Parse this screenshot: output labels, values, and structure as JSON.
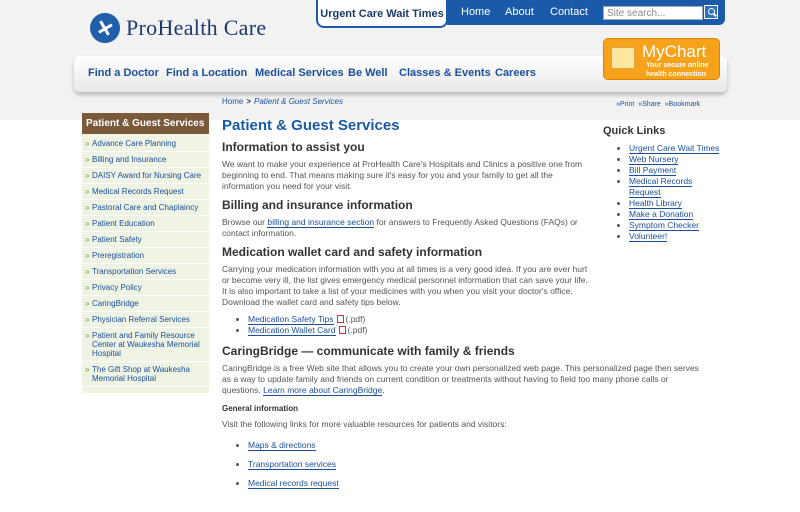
{
  "header": {
    "logo_text": "ProHealth Care",
    "urgent_care_tab": "Urgent Care Wait Times",
    "top_links": [
      "Home",
      "About",
      "Contact"
    ],
    "search_placeholder": "Site search...",
    "nav": [
      "Find a Doctor",
      "Find a Location",
      "Medical Services",
      "Be Well",
      "Classes & Events",
      "Careers"
    ],
    "mychart": {
      "title": "MyChart",
      "subtitle": "Your secure online health connection"
    }
  },
  "breadcrumb": {
    "home": "Home",
    "sep": ">",
    "current": "Patient & Guest Services"
  },
  "tools": [
    "»Print",
    "»Share",
    "»Bookmark"
  ],
  "sidebar": {
    "title": "Patient & Guest Services",
    "items": [
      "Advance Care Planning",
      "Billing and Insurance",
      "DAISY Award for Nursing Care",
      "Medical Records Request",
      "Pastoral Care and Chaplaincy",
      "Patient Education",
      "Patient Safety",
      "Preregistration",
      "Transportation Services",
      "Privacy Policy",
      "CaringBridge",
      "Physician Referral Services",
      "Patient and Family Resource Center at Waukesha Memorial Hospital",
      "The Gift Shop at Waukesha Memorial Hospital"
    ]
  },
  "main": {
    "title": "Patient & Guest Services",
    "assist_heading": "Information to assist you",
    "assist_text": "We want to make your experience at ProHealth Care's Hospitals and Clinics a positive one from beginning to end. That means making sure it's easy for you and your family to get all the information you need for your visit.",
    "billing_heading": "Billing and insurance information",
    "billing_text_pre": "Browse our ",
    "billing_link": "billing and insurance section",
    "billing_text_post": " for answers to Frequently Asked Questions (FAQs) or contact information.",
    "wallet_heading": "Medication wallet card and safety information",
    "wallet_text": "Carrying your medication information with you at all times is a very good idea. If you are ever hurt or become very ill, the list gives emergency medical personnel information that can save your life. It is also important to take a list of your medicines with you when you visit your doctor's office. Download the wallet card and safety tips below.",
    "pdf_links": [
      "Medication Safety Tips",
      "Medication Wallet Card"
    ],
    "pdf_suffix": "(.pdf)",
    "caring_heading": "CaringBridge — communicate with family & friends",
    "caring_text": "CaringBridge is a free Web site that allows you to create your own personalized web page.  This personalized page then serves as a way to update family and friends on current condition or treatments without having to field too many phone calls or questions. ",
    "caring_link": "Learn more about CaringBridge",
    "caring_text_end": ".",
    "general_heading": "General information",
    "general_text": "Visit the following links for more valuable resources for patients and visitors:",
    "resources": [
      "Maps & directions",
      "Transportation services",
      "Medical records request"
    ]
  },
  "quick_links": {
    "title": "Quick Links",
    "items": [
      "Urgent Care Wait Times",
      "Web Nursery",
      "Bill Payment",
      "Medical Records Request",
      "Health Library",
      "Make a Donation",
      "Symptom Checker",
      "Volunteer!"
    ]
  }
}
